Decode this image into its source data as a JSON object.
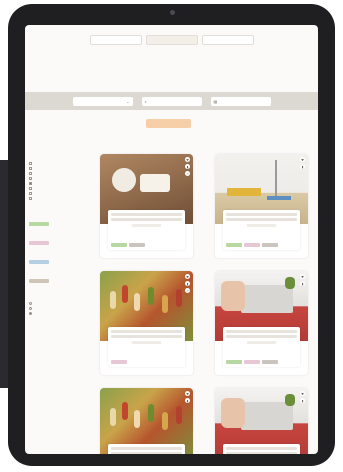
{
  "tabs": [
    {
      "label": "",
      "active": false
    },
    {
      "label": "",
      "active": true
    },
    {
      "label": "",
      "active": false
    }
  ],
  "intro": {
    "lines": [
      "",
      "",
      ""
    ]
  },
  "search": {
    "field1": {
      "placeholder": "",
      "icon": "chevron-down-icon"
    },
    "field2": {
      "placeholder": "",
      "icon": "search-icon"
    },
    "field3": {
      "placeholder": "",
      "icon": "calendar-icon"
    }
  },
  "cta": {
    "label": "",
    "note": ""
  },
  "sidebar": {
    "groups": [
      {
        "title": "",
        "type": "checkbox",
        "items": [
          {
            "label": "",
            "checked": false
          },
          {
            "label": "",
            "checked": false
          },
          {
            "label": "",
            "checked": false
          },
          {
            "label": "",
            "checked": false
          },
          {
            "label": "",
            "checked": true
          },
          {
            "label": "",
            "checked": false
          },
          {
            "label": "",
            "checked": false
          },
          {
            "label": "",
            "checked": false
          }
        ]
      },
      {
        "title": "",
        "type": "tags",
        "tag_colors": [
          "#b7d8a0",
          "#e8c7d5",
          "#b4cfe1",
          "#cfc6b7"
        ]
      },
      {
        "title": "",
        "type": "radio",
        "items": [
          {
            "label": "",
            "checked": false
          },
          {
            "label": "",
            "checked": false
          },
          {
            "label": "",
            "checked": true
          }
        ]
      }
    ]
  },
  "cards": [
    {
      "photo": "soap",
      "title": "",
      "title2": "",
      "meta": "",
      "tag_colors": [
        "#b7d8a0",
        "#c9c4bd"
      ]
    },
    {
      "photo": "floor",
      "title": "",
      "title2": "",
      "meta": "",
      "tag_colors": [
        "#b7d8a0",
        "#e8c7d5",
        "#c9c4bd"
      ]
    },
    {
      "photo": "skewer",
      "title": "",
      "title2": "",
      "meta": "",
      "tag_colors": [
        "#e8c7d5"
      ]
    },
    {
      "photo": "printer",
      "title": "",
      "title2": "",
      "meta": "",
      "tag_colors": [
        "#b7d8a0",
        "#e8c7d5",
        "#c9c4bd"
      ]
    },
    {
      "photo": "skewer",
      "title": "",
      "title2": "",
      "meta": "",
      "tag_colors": []
    },
    {
      "photo": "printer",
      "title": "",
      "title2": "",
      "meta": "",
      "tag_colors": []
    }
  ],
  "colors": {
    "accent": "#f6cfa9",
    "tablet_frame": "#1f1f22",
    "page_background": "#fbfaf9"
  }
}
